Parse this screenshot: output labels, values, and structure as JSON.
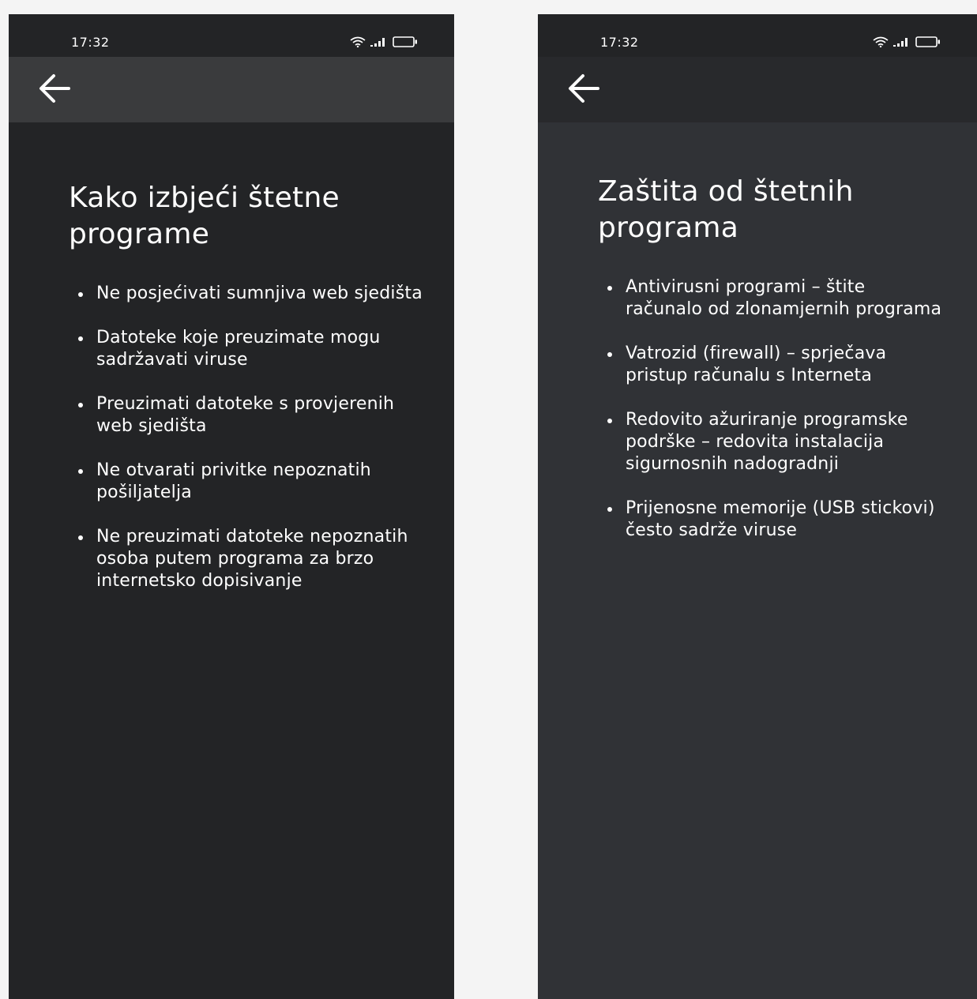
{
  "screens": [
    {
      "status_time": "17:32",
      "title": "Kako izbjeći štetne programe",
      "items": [
        "Ne posjećivati sumnjiva web sjedišta",
        "Datoteke koje preuzimate mogu sadržavati viruse",
        "Preuzimati datoteke s provjerenih web sjedišta",
        "Ne otvarati privitke nepoznatih pošiljatelja",
        "Ne preuzimati datoteke nepoznatih osoba putem programa za brzo internetsko dopisivanje"
      ]
    },
    {
      "status_time": "17:32",
      "title": "Zaštita od štetnih programa",
      "items": [
        "Antivirusni programi – štite računalo od zlonamjernih programa",
        "Vatrozid (firewall) – sprječava pristup računalu s Interneta",
        "Redovito ažuriranje programske podrške – redovita instalacija sigurnosnih nadogradnji",
        "Prijenosne memorije (USB stickovi) često sadrže viruse"
      ]
    }
  ],
  "icons": {
    "back": "arrow-left-icon",
    "wifi": "wifi-icon",
    "signal": "signal-icon",
    "battery": "battery-icon"
  },
  "colors": {
    "page_background": "#f4f4f4",
    "left_screen_background": "#232426",
    "right_screen_background": "#303236",
    "text": "#ffffff"
  }
}
